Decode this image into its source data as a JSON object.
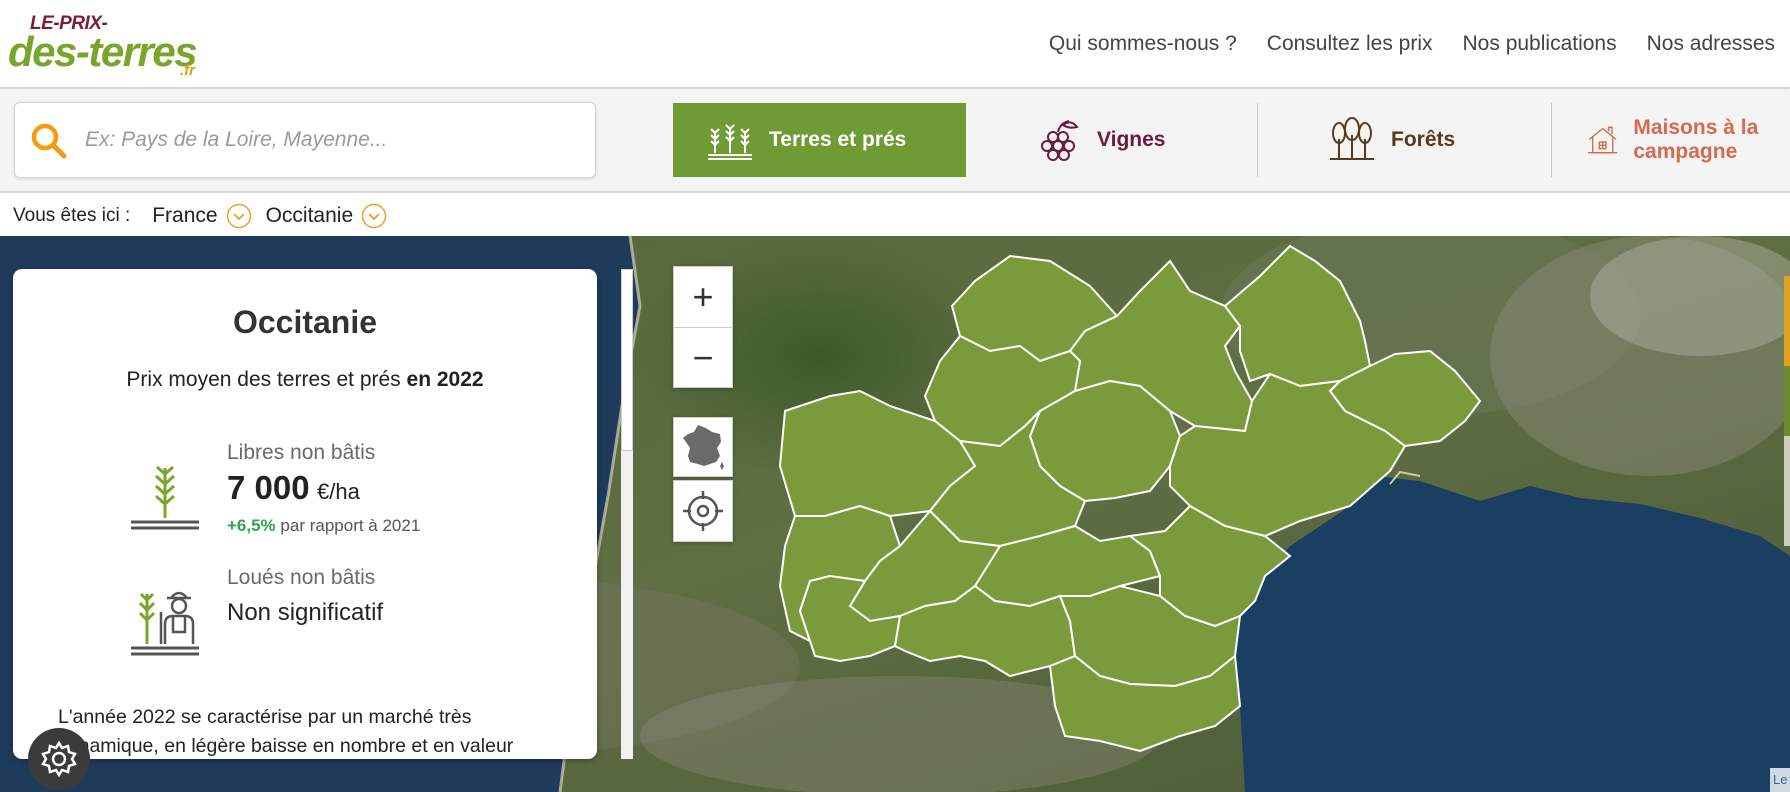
{
  "header": {
    "logo": {
      "top": "LE-PRIX-",
      "main": "des-terres",
      "suffix": ".fr"
    },
    "nav": [
      "Qui sommes-nous ?",
      "Consultez les prix",
      "Nos publications",
      "Nos adresses"
    ]
  },
  "search": {
    "placeholder": "Ex: Pays de la Loire, Mayenne..."
  },
  "categories": [
    {
      "label": "Terres et prés",
      "icon": "wheat-field-icon",
      "active": true
    },
    {
      "label": "Vignes",
      "icon": "grapes-icon",
      "active": false
    },
    {
      "label": "Forêts",
      "icon": "trees-icon",
      "active": false
    },
    {
      "label": "Maisons à la campagne",
      "icon": "house-icon",
      "active": false
    }
  ],
  "breadcrumb": {
    "label": "Vous êtes ici :",
    "items": [
      "France",
      "Occitanie"
    ]
  },
  "panel": {
    "title": "Occitanie",
    "subtitle_prefix": "Prix moyen des terres et prés",
    "subtitle_year": "en 2022",
    "stats": [
      {
        "label": "Libres non bâtis",
        "value": "7 000",
        "unit": "€/ha",
        "change": "+6,5%",
        "change_suffix": "par rapport à 2021",
        "icon": "wheat-icon"
      },
      {
        "label": "Loués non bâtis",
        "value": "Non significatif",
        "icon": "farmer-wheat-icon"
      }
    ],
    "text": "L'année 2022 se caractérise par un marché très dynamique, en légère baisse en nombre et en valeur"
  },
  "map": {
    "controls": {
      "zoom_in": "+",
      "zoom_out": "−"
    },
    "attribution": "Le",
    "region_color": "#7a9a3c"
  },
  "colors": {
    "brand_green": "#6f9b35",
    "vignes": "#6b1b3e",
    "maisons": "#d46a4f",
    "accent_orange": "#e59c12"
  }
}
